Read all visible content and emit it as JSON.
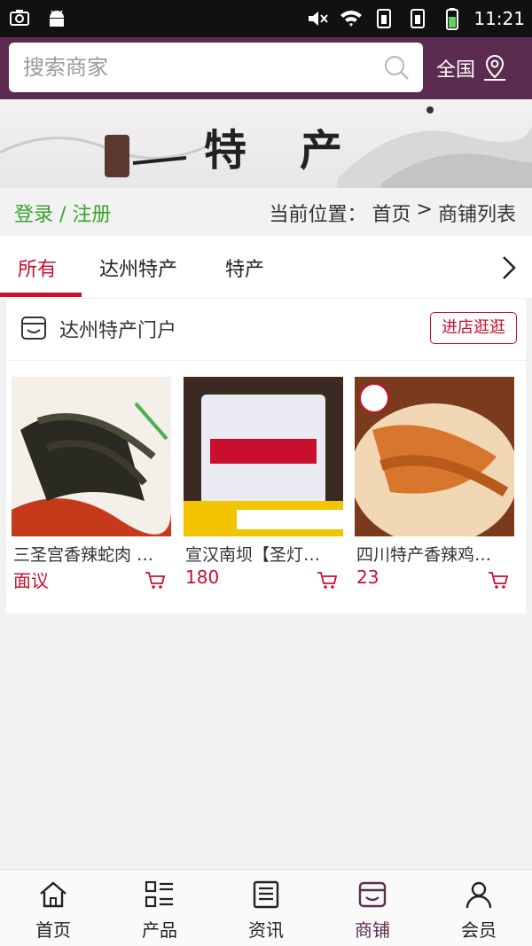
{
  "status_bar": {
    "time": "11:21"
  },
  "search": {
    "placeholder": "搜索商家",
    "region_label": "全国"
  },
  "banner": {
    "title": "特产"
  },
  "breadcrumb": {
    "login_label": "登录 / 注册",
    "prefix": "当前位置：",
    "home": "首页",
    "separator": ">",
    "current": "商铺列表"
  },
  "tabs": [
    {
      "label": "所有",
      "active": true
    },
    {
      "label": "达州特产",
      "active": false
    },
    {
      "label": "特产",
      "active": false
    }
  ],
  "shop": {
    "name": "达州特产门户",
    "visit_label": "进店逛逛",
    "products": [
      {
        "name": "三圣宫香辣蛇肉 …",
        "price": "面议"
      },
      {
        "name": "宣汉南坝【圣灯…",
        "price": "180"
      },
      {
        "name": "四川特产香辣鸡…",
        "price": "23"
      }
    ]
  },
  "bottom_nav": [
    {
      "label": "首页",
      "icon": "home-icon",
      "active": false
    },
    {
      "label": "产品",
      "icon": "grid-list-icon",
      "active": false
    },
    {
      "label": "资讯",
      "icon": "news-icon",
      "active": false
    },
    {
      "label": "商铺",
      "icon": "shop-icon",
      "active": true
    },
    {
      "label": "会员",
      "icon": "user-icon",
      "active": false
    }
  ],
  "colors": {
    "header": "#5b2c4f",
    "accent": "#c8102e",
    "login": "#3aa12e"
  }
}
